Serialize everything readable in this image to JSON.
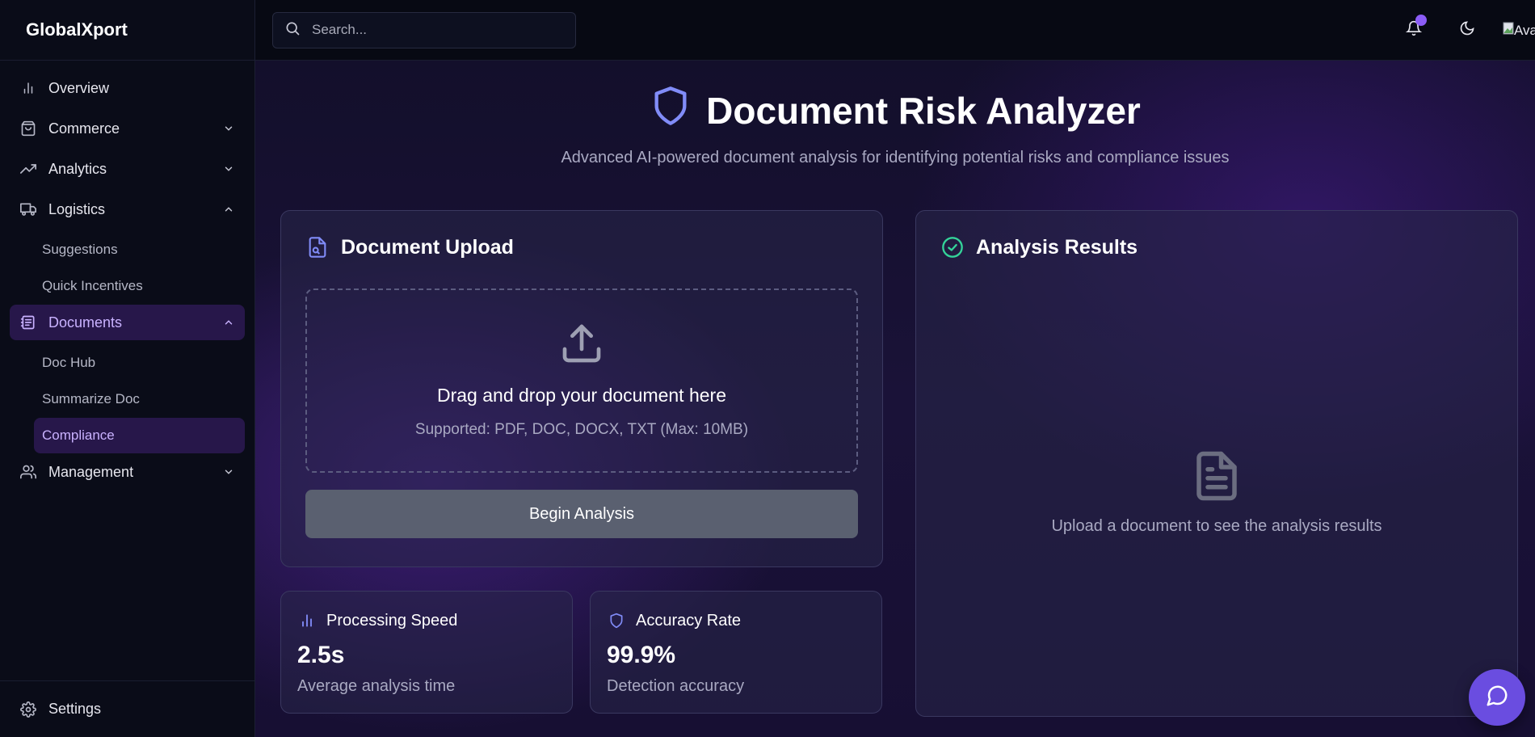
{
  "app": {
    "brand": "GlobalXport"
  },
  "sidebar": {
    "items": [
      {
        "label": "Overview",
        "icon": "bar-chart-icon"
      },
      {
        "label": "Commerce",
        "icon": "shopping-bag-icon",
        "expanded": false
      },
      {
        "label": "Analytics",
        "icon": "trending-up-icon",
        "expanded": false
      },
      {
        "label": "Logistics",
        "icon": "truck-icon",
        "expanded": true,
        "children": [
          {
            "label": "Suggestions"
          },
          {
            "label": "Quick Incentives"
          }
        ]
      },
      {
        "label": "Documents",
        "icon": "documents-icon",
        "expanded": true,
        "active": true,
        "children": [
          {
            "label": "Doc Hub"
          },
          {
            "label": "Summarize Doc"
          },
          {
            "label": "Compliance",
            "active": true
          }
        ]
      },
      {
        "label": "Management",
        "icon": "users-icon",
        "expanded": false
      }
    ],
    "footer": {
      "label": "Settings",
      "icon": "gear-icon"
    }
  },
  "topbar": {
    "search_placeholder": "Search...",
    "avatar_alt": "Ava",
    "notification_badge": true
  },
  "hero": {
    "title": "Document Risk Analyzer",
    "subtitle": "Advanced AI-powered document analysis for identifying potential risks and compliance issues"
  },
  "upload": {
    "title": "Document Upload",
    "drop_title": "Drag and drop your document here",
    "drop_sub": "Supported: PDF, DOC, DOCX, TXT (Max: 10MB)",
    "button": "Begin Analysis"
  },
  "stats": {
    "speed": {
      "label": "Processing Speed",
      "value": "2.5s",
      "desc": "Average analysis time"
    },
    "accuracy": {
      "label": "Accuracy Rate",
      "value": "99.9%",
      "desc": "Detection accuracy"
    }
  },
  "results": {
    "title": "Analysis Results",
    "empty": "Upload a document to see the analysis results"
  },
  "colors": {
    "accent": "#8b5cf6",
    "active_bg": "#27174a",
    "active_text": "#c9b2ff",
    "success": "#34d399",
    "button_disabled": "#5a6070",
    "chat_fab": "#6a4de0"
  }
}
